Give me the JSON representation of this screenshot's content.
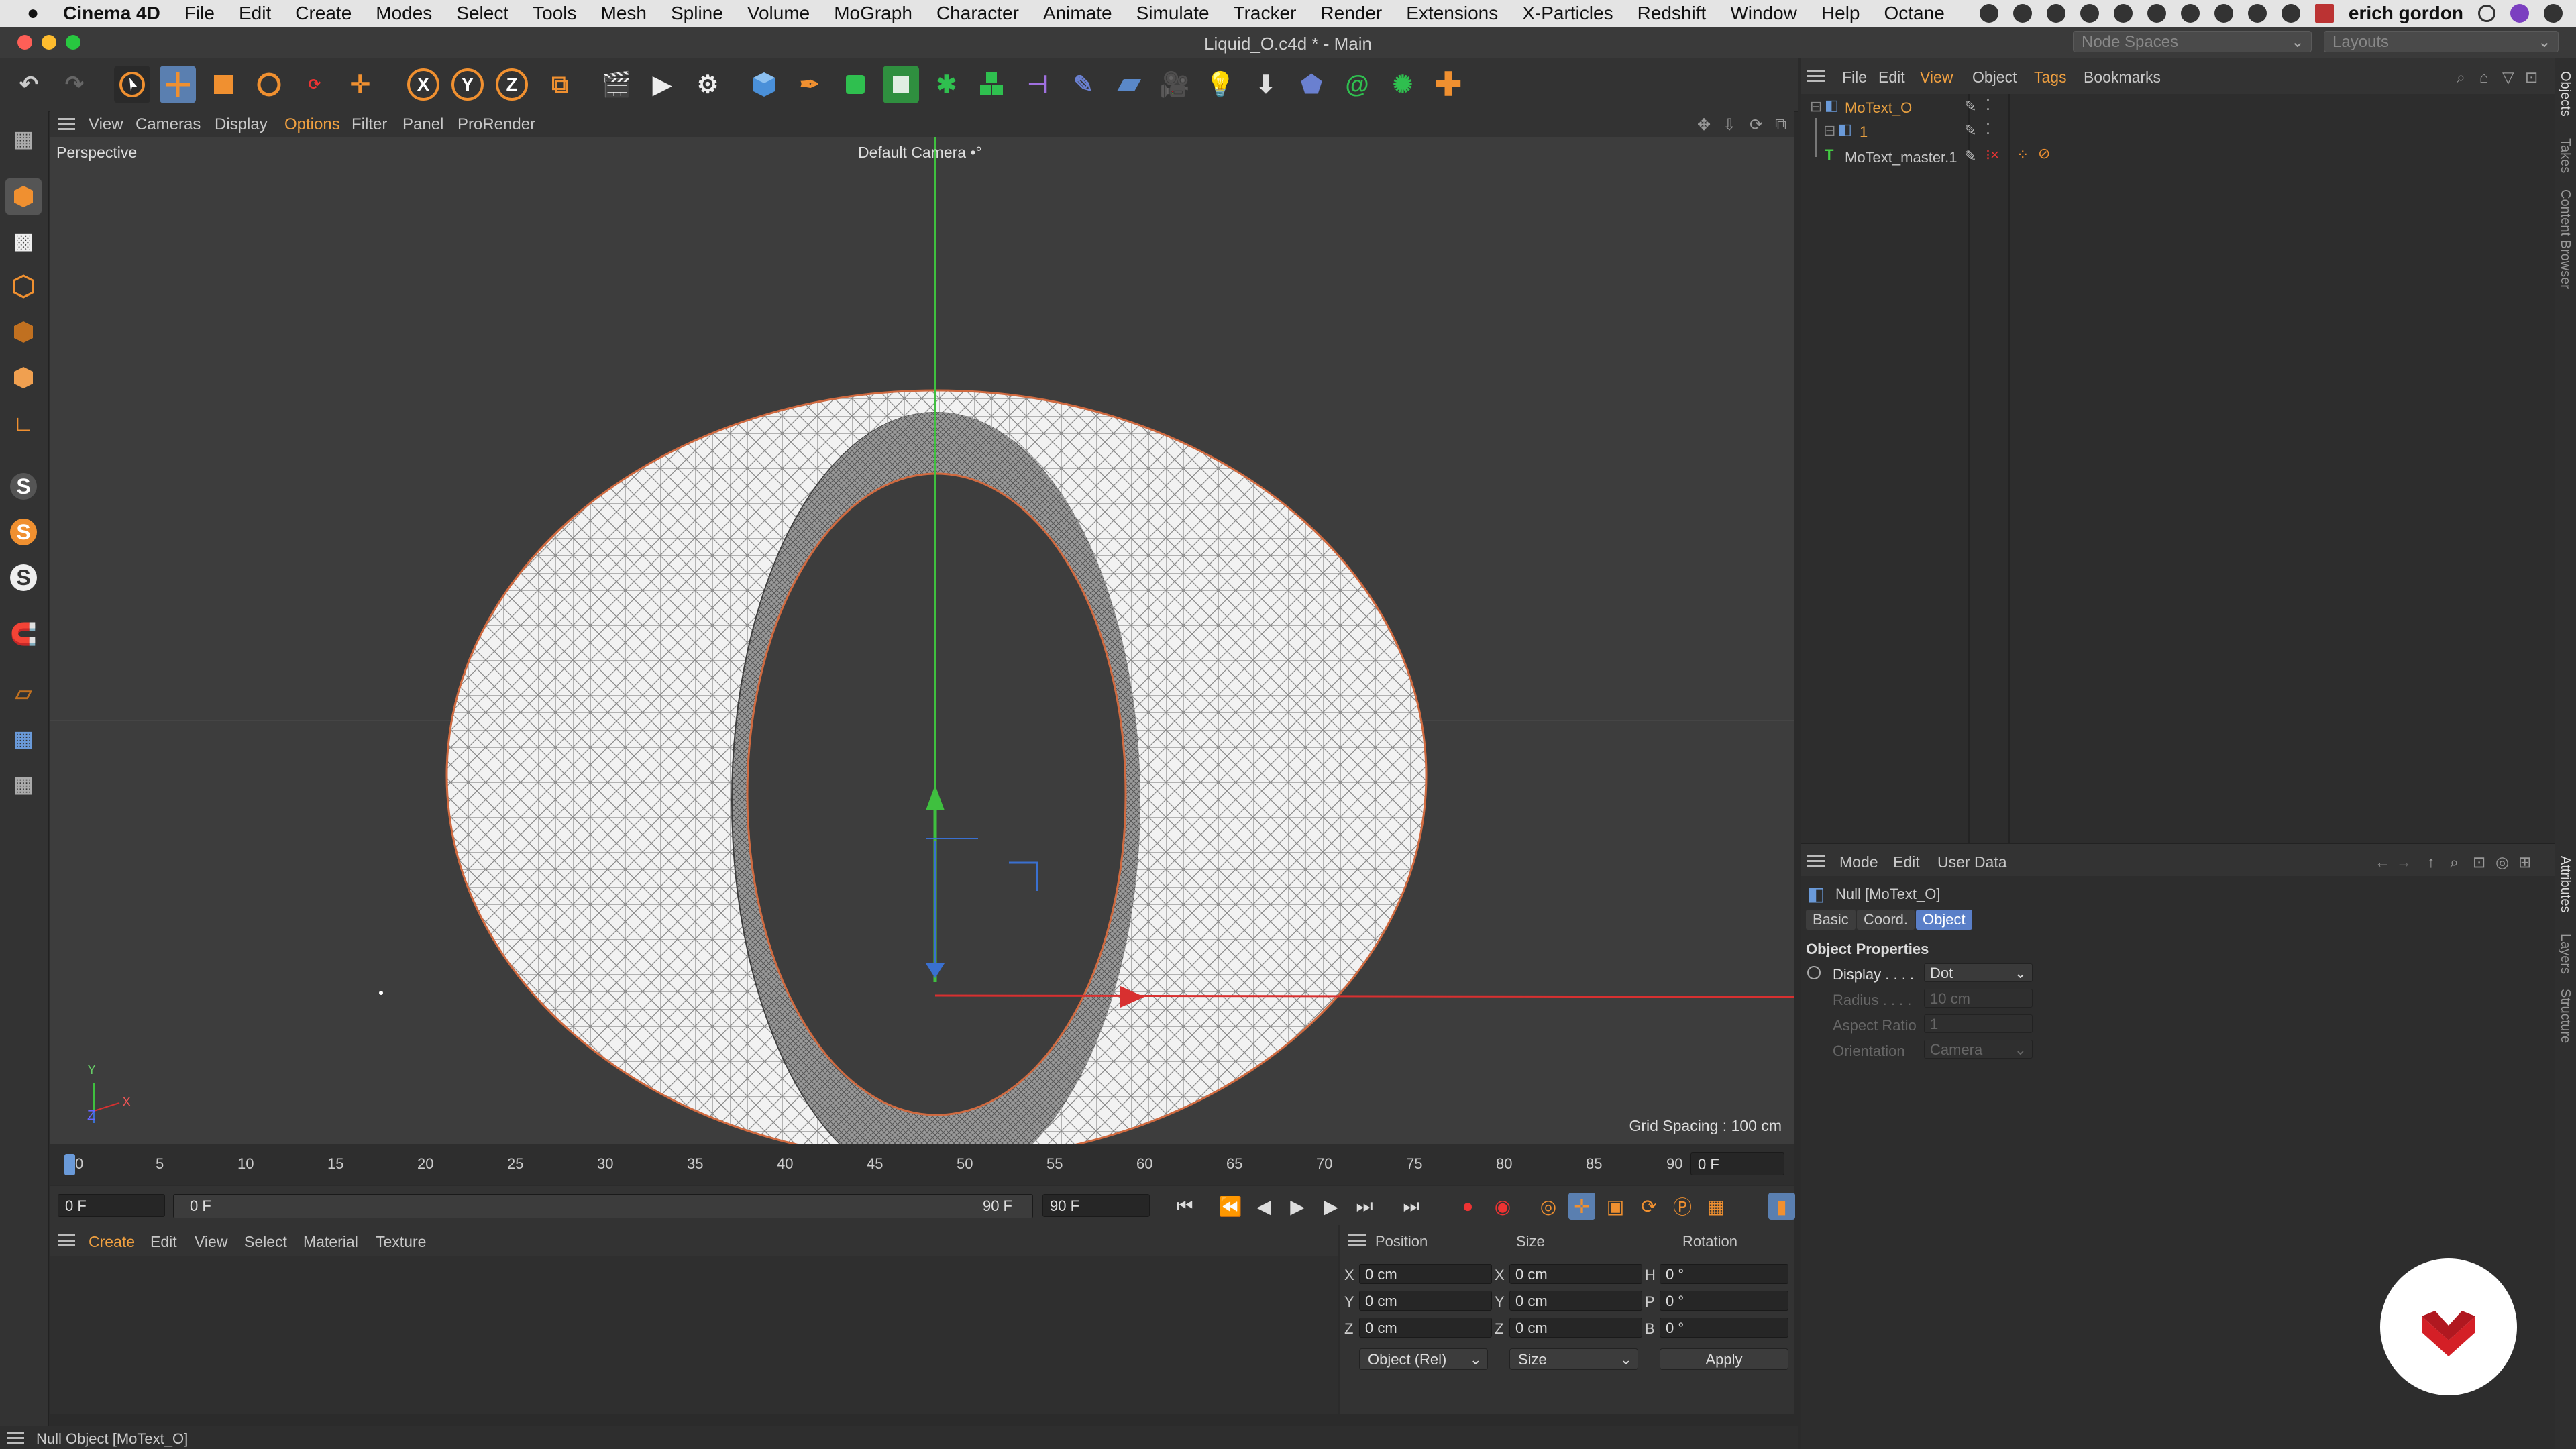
{
  "menubar": {
    "app_name": "Cinema 4D",
    "items": [
      "File",
      "Edit",
      "Create",
      "Modes",
      "Select",
      "Tools",
      "Mesh",
      "Spline",
      "Volume",
      "MoGraph",
      "Character",
      "Animate",
      "Simulate",
      "Tracker",
      "Render",
      "Extensions",
      "X-Particles",
      "Redshift",
      "Window",
      "Help",
      "Octane"
    ],
    "user": "erich gordon"
  },
  "window": {
    "title": "Liquid_O.c4d * - Main",
    "node_spaces": "Node Spaces",
    "layouts": "Layouts"
  },
  "toolbar": {
    "axis_x": "X",
    "axis_y": "Y",
    "axis_z": "Z"
  },
  "left_toolbar": {
    "s1": "S",
    "s2": "S",
    "s3": "S"
  },
  "viewport": {
    "menu": [
      "View",
      "Cameras",
      "Display",
      "Options",
      "Filter",
      "Panel",
      "ProRender"
    ],
    "active_menu": "Options",
    "label": "Perspective",
    "camera": "Default Camera",
    "grid_spacing": "Grid Spacing : 100 cm",
    "axis_y": "Y",
    "axis_x": "X",
    "axis_z": "Z"
  },
  "timeline": {
    "ticks": [
      "0",
      "5",
      "10",
      "15",
      "20",
      "25",
      "30",
      "35",
      "40",
      "45",
      "50",
      "55",
      "60",
      "65",
      "70",
      "75",
      "80",
      "85",
      "90"
    ],
    "current_frame_right": "0 F",
    "start_field": "0 F",
    "range_start": "0 F",
    "range_end": "90 F",
    "end_field": "90 F"
  },
  "material_menu": [
    "Create",
    "Edit",
    "View",
    "Select",
    "Material",
    "Texture"
  ],
  "coords": {
    "headers": [
      "Position",
      "Size",
      "Rotation"
    ],
    "rows": [
      {
        "axis": "X",
        "pos": "0 cm",
        "size_axis": "X",
        "size": "0 cm",
        "rot_axis": "H",
        "rot": "0 °"
      },
      {
        "axis": "Y",
        "pos": "0 cm",
        "size_axis": "Y",
        "size": "0 cm",
        "rot_axis": "P",
        "rot": "0 °"
      },
      {
        "axis": "Z",
        "pos": "0 cm",
        "size_axis": "Z",
        "size": "0 cm",
        "rot_axis": "B",
        "rot": "0 °"
      }
    ],
    "mode_dropdown": "Object (Rel)",
    "size_dropdown": "Size",
    "apply": "Apply"
  },
  "status": "Null Object [MoText_O]",
  "objects": {
    "menu": [
      "File",
      "Edit",
      "View",
      "Object",
      "Tags",
      "Bookmarks"
    ],
    "items": [
      {
        "name": "MoText_O",
        "color": "#e8a040"
      },
      {
        "name": "1",
        "color": "#e8a040"
      },
      {
        "name": "MoText_master.1",
        "color": "#c8c8c8"
      }
    ]
  },
  "attributes": {
    "menu": [
      "Mode",
      "Edit",
      "User Data"
    ],
    "object_title": "Null [MoText_O]",
    "tabs": [
      "Basic",
      "Coord.",
      "Object"
    ],
    "active_tab": "Object",
    "section": "Object Properties",
    "props": [
      {
        "label": "Display . . . .",
        "value": "Dot",
        "enabled": true
      },
      {
        "label": "Radius . . . .",
        "value": "10 cm",
        "enabled": false
      },
      {
        "label": "Aspect Ratio",
        "value": "1",
        "enabled": false
      },
      {
        "label": "Orientation",
        "value": "Camera",
        "enabled": false
      }
    ]
  },
  "side_tabs": [
    "Objects",
    "Takes",
    "Content Browser",
    "Attributes",
    "Layers",
    "Structure"
  ]
}
